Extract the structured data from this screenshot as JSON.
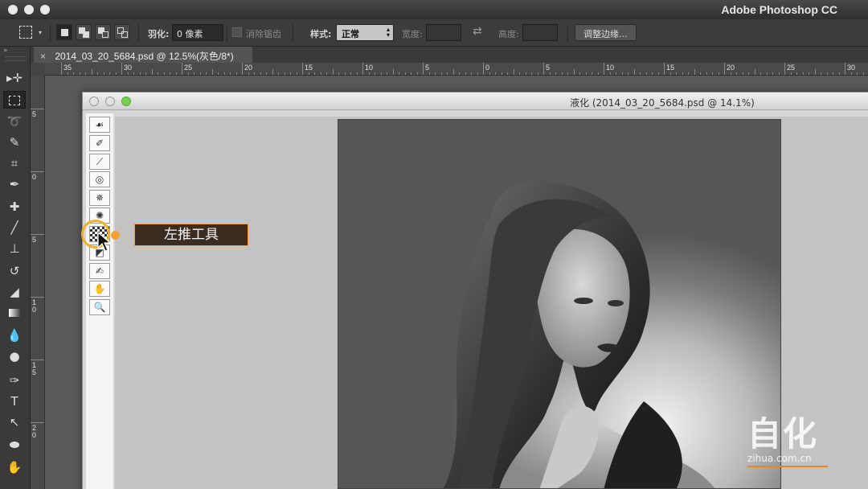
{
  "app": {
    "title": "Adobe Photoshop CC"
  },
  "options_bar": {
    "feather_label": "羽化:",
    "feather_value": "0 像素",
    "anti_alias_label": "消除锯齿",
    "style_label": "样式:",
    "style_value": "正常",
    "width_label": "宽度:",
    "height_label": "高度:",
    "refine_edge_button": "调整边缘..."
  },
  "document": {
    "tab_close": "×",
    "tab_title": "2014_03_20_5684.psd @ 12.5%(灰色/8*)"
  },
  "ruler_h": [
    "35",
    "30",
    "25",
    "20",
    "15",
    "10",
    "5",
    "0",
    "5",
    "10",
    "15",
    "20",
    "25",
    "30"
  ],
  "ruler_v": [
    "5",
    "0",
    "5",
    "1\n0",
    "1\n5",
    "2\n0"
  ],
  "liquify": {
    "title": "液化 (2014_03_20_5684.psd @ 14.1%)",
    "tools": [
      "forward-warp",
      "reconstruct",
      "smooth",
      "twirl-clockwise",
      "pucker",
      "bloat",
      "push-left",
      "freeze-mask",
      "thaw-mask",
      "hand",
      "zoom"
    ]
  },
  "tooltip": {
    "label": "左推工具"
  },
  "watermark": {
    "big": "自化",
    "small": "zihua.com.cn"
  },
  "colors": {
    "accent": "#f0b22a",
    "tooltip_bg": "#3b2c22",
    "watermark_line": "#e58a1a"
  }
}
